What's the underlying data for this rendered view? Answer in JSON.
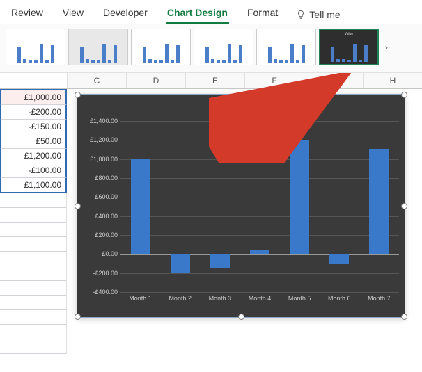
{
  "ribbon": {
    "tabs": [
      "Review",
      "View",
      "Developer",
      "Chart Design",
      "Format"
    ],
    "active_tab": "Chart Design",
    "tell_me": "Tell me"
  },
  "columns": [
    "C",
    "D",
    "E",
    "F",
    "G",
    "H"
  ],
  "cells": [
    "£1,000.00",
    "-£200.00",
    "-£150.00",
    "£50.00",
    "£1,200.00",
    "-£100.00",
    "£1,100.00"
  ],
  "chart_data": {
    "type": "bar",
    "title": "Value",
    "categories": [
      "Month 1",
      "Month 2",
      "Month 3",
      "Month 4",
      "Month 5",
      "Month 6",
      "Month 7"
    ],
    "values": [
      1000,
      -200,
      -150,
      50,
      1200,
      -100,
      1100
    ],
    "ylim": [
      -400,
      1400
    ],
    "yticks": [
      -400,
      -200,
      0,
      200,
      400,
      600,
      800,
      1000,
      1200,
      1400
    ],
    "ytick_labels": [
      "-£400.00",
      "-£200.00",
      "£0.00",
      "£200.00",
      "£400.00",
      "£600.00",
      "£800.00",
      "£1,000.00",
      "£1,200.00",
      "£1,400.00"
    ],
    "xlabel": "",
    "ylabel": ""
  },
  "gallery_styles": 6
}
